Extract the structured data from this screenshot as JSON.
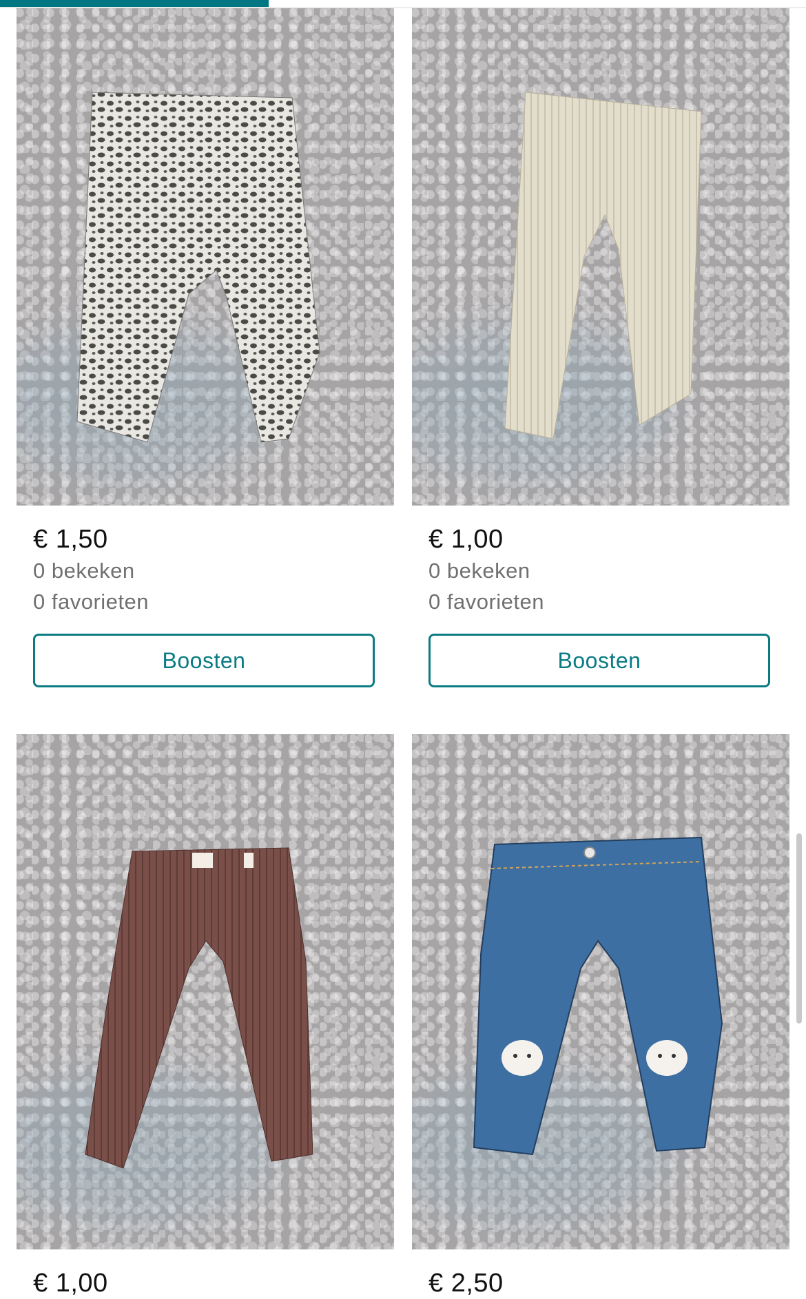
{
  "progress": {
    "fraction": 0.333,
    "color": "#007782"
  },
  "accent_color": "#0a7b82",
  "items": [
    {
      "image_label": "leopard-print leggings",
      "garment_color": "#8e8f8c",
      "price": "€ 1,50",
      "views": "0 bekeken",
      "favorites": "0 favorieten",
      "button_label": "Boosten"
    },
    {
      "image_label": "cream ribbed leggings",
      "garment_color": "#e2dccb",
      "price": "€ 1,00",
      "views": "0 bekeken",
      "favorites": "0 favorieten",
      "button_label": "Boosten"
    },
    {
      "image_label": "brown ribbed leggings",
      "garment_color": "#7a4f49",
      "price": "€ 1,00"
    },
    {
      "image_label": "blue denim jeans with cat knee patches",
      "garment_color": "#3d6fa3",
      "price": "€ 2,50"
    }
  ]
}
